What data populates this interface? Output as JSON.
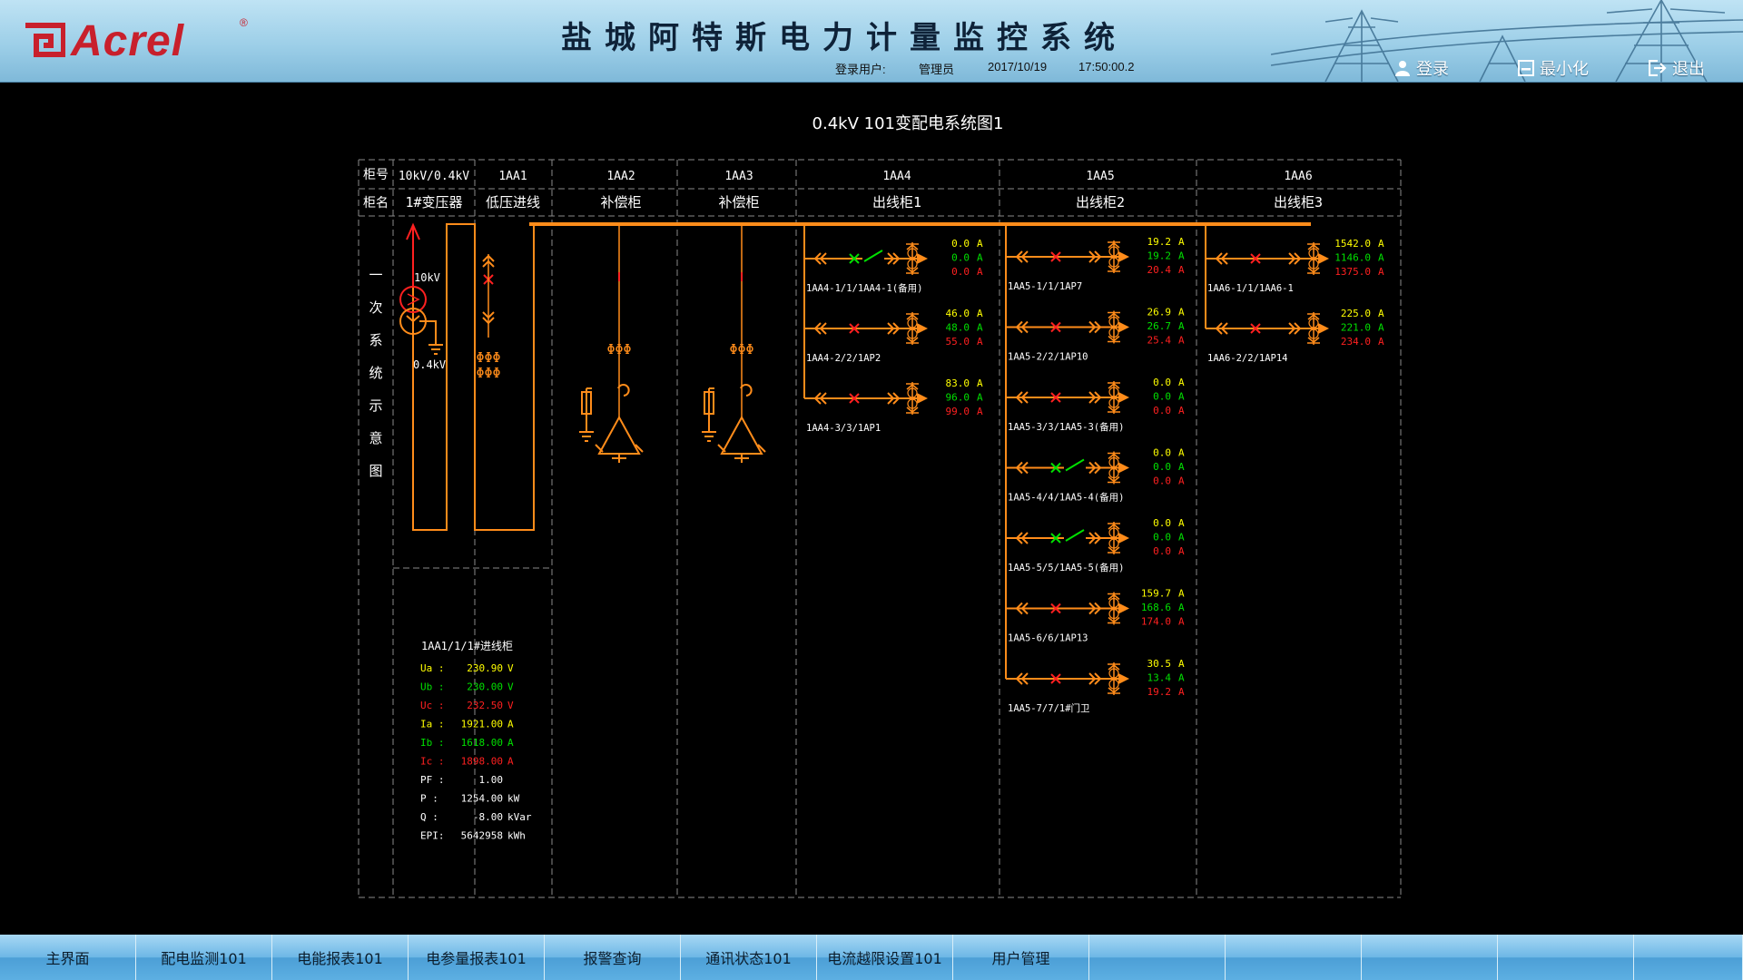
{
  "header": {
    "logo_text": "Acrel",
    "logo_reg": "®",
    "title": "盐城阿特斯电力计量监控系统",
    "login_label": "登录用户:",
    "user": "管理员",
    "date": "2017/10/19",
    "time": "17:50:00.2",
    "buttons": {
      "login": "登录",
      "minimize": "最小化",
      "exit": "退出"
    }
  },
  "diagram": {
    "title": "0.4kV 101变配电系统图1",
    "row_labels": {
      "cabinet_no": "柜号",
      "cabinet_name": "柜名"
    },
    "side_label": [
      "一",
      "次",
      "系",
      "统",
      "示",
      "意",
      "图"
    ],
    "cabinets": [
      {
        "no": "10kV/0.4kV",
        "name": "1#变压器"
      },
      {
        "no": "1AA1",
        "name": "低压进线"
      },
      {
        "no": "1AA2",
        "name": "补偿柜"
      },
      {
        "no": "1AA3",
        "name": "补偿柜"
      },
      {
        "no": "1AA4",
        "name": "出线柜1"
      },
      {
        "no": "1AA5",
        "name": "出线柜2"
      },
      {
        "no": "1AA6",
        "name": "出线柜3"
      }
    ],
    "transformer": {
      "hv": "10kV",
      "lv": "0.4kV"
    },
    "colors": {
      "yellow": "#ffff00",
      "green": "#00e000",
      "red": "#ff2020",
      "orange": "#ff8c1a",
      "grid": "#8a8a8a"
    },
    "feeders": [
      {
        "name": "1AA4-1/1/1AA4-1(备用)",
        "switch": "open",
        "a": "0.0",
        "b": "0.0",
        "c": "0.0",
        "unit": "A"
      },
      {
        "name": "1AA4-2/2/1AP2",
        "switch": "closed",
        "a": "46.0",
        "b": "48.0",
        "c": "55.0",
        "unit": "A"
      },
      {
        "name": "1AA4-3/3/1AP1",
        "switch": "closed",
        "a": "83.0",
        "b": "96.0",
        "c": "99.0",
        "unit": "A"
      },
      {
        "name": "1AA5-1/1/1AP7",
        "switch": "closed",
        "a": "19.2",
        "b": "19.2",
        "c": "20.4",
        "unit": "A"
      },
      {
        "name": "1AA5-2/2/1AP10",
        "switch": "closed",
        "a": "26.9",
        "b": "26.7",
        "c": "25.4",
        "unit": "A"
      },
      {
        "name": "1AA5-3/3/1AA5-3(备用)",
        "switch": "closed",
        "a": "0.0",
        "b": "0.0",
        "c": "0.0",
        "unit": "A"
      },
      {
        "name": "1AA5-4/4/1AA5-4(备用)",
        "switch": "open",
        "a": "0.0",
        "b": "0.0",
        "c": "0.0",
        "unit": "A"
      },
      {
        "name": "1AA5-5/5/1AA5-5(备用)",
        "switch": "open",
        "a": "0.0",
        "b": "0.0",
        "c": "0.0",
        "unit": "A"
      },
      {
        "name": "1AA5-6/6/1AP13",
        "switch": "closed",
        "a": "159.7",
        "b": "168.6",
        "c": "174.0",
        "unit": "A"
      },
      {
        "name": "1AA5-7/7/1#门卫",
        "switch": "closed",
        "a": "30.5",
        "b": "13.4",
        "c": "19.2",
        "unit": "A"
      },
      {
        "name": "1AA6-1/1/1AA6-1",
        "switch": "closed",
        "a": "1542.0",
        "b": "1146.0",
        "c": "1375.0",
        "unit": "A"
      },
      {
        "name": "1AA6-2/2/1AP14",
        "switch": "closed",
        "a": "225.0",
        "b": "221.0",
        "c": "234.0",
        "unit": "A"
      }
    ],
    "incoming": {
      "title": "1AA1/1/1#进线柜",
      "rows": [
        {
          "label": "Ua",
          "value": "230.90",
          "unit": "V",
          "color": "#ffff00"
        },
        {
          "label": "Ub",
          "value": "230.00",
          "unit": "V",
          "color": "#00e000"
        },
        {
          "label": "Uc",
          "value": "232.50",
          "unit": "V",
          "color": "#ff2020"
        },
        {
          "label": "Ia",
          "value": "1921.00",
          "unit": "A",
          "color": "#ffff00"
        },
        {
          "label": "Ib",
          "value": "1618.00",
          "unit": "A",
          "color": "#00e000"
        },
        {
          "label": "Ic",
          "value": "1898.00",
          "unit": "A",
          "color": "#ff2020"
        },
        {
          "label": "PF",
          "value": "1.00",
          "unit": "",
          "color": "#ffffff"
        },
        {
          "label": "P",
          "value": "1254.00",
          "unit": "kW",
          "color": "#ffffff"
        },
        {
          "label": "Q",
          "value": "-8.00",
          "unit": "kVar",
          "color": "#ffffff"
        },
        {
          "label": "EPI",
          "value": "5642958",
          "unit": "kWh",
          "color": "#ffffff"
        }
      ]
    }
  },
  "nav": {
    "tabs": [
      "主界面",
      "配电监测101",
      "电能报表101",
      "电参量报表101",
      "报警查询",
      "通讯状态101",
      "电流越限设置101",
      "用户管理",
      "",
      "",
      "",
      "",
      ""
    ]
  }
}
